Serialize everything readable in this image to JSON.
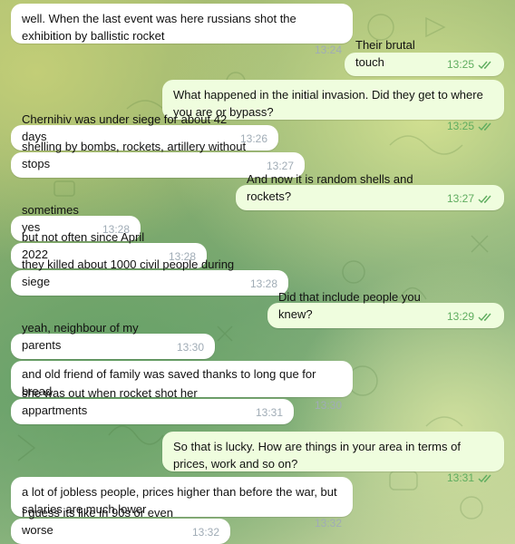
{
  "colors": {
    "incoming_bubble": "#ffffff",
    "outgoing_bubble": "#effdde",
    "time_incoming": "#a0acb6",
    "time_outgoing": "#5fad5f"
  },
  "messages": [
    {
      "direction": "in",
      "text": "well. When the last event was here russians shot the exhibition by ballistic rocket",
      "time": "13:24"
    },
    {
      "direction": "out",
      "text": "Their brutal touch",
      "time": "13:25",
      "read": true
    },
    {
      "direction": "out",
      "text": "What happened in the initial invasion. Did they get to where you are or bypass?",
      "time": "13:25",
      "read": true
    },
    {
      "direction": "in",
      "text": "Chernihiv was under siege for about 42 days",
      "time": "13:26"
    },
    {
      "direction": "in",
      "text": "shelling by bombs, rockets, artillery without stops",
      "time": "13:27"
    },
    {
      "direction": "out",
      "text": "And now it is random shells and rockets?",
      "time": "13:27",
      "read": true
    },
    {
      "direction": "in",
      "text": "sometimes yes",
      "time": "13:28"
    },
    {
      "direction": "in",
      "text": "but not often since April 2022",
      "time": "13:28"
    },
    {
      "direction": "in",
      "text": "they killed about 1000 civil people during siege",
      "time": "13:28"
    },
    {
      "direction": "out",
      "text": "Did that include people you knew?",
      "time": "13:29",
      "read": true
    },
    {
      "direction": "in",
      "text": "yeah, neighbour of my parents",
      "time": "13:30"
    },
    {
      "direction": "in",
      "text": "and old friend of family was saved thanks to long que for bread",
      "time": "13:30"
    },
    {
      "direction": "in",
      "text": "she was out when rocket shot her appartments",
      "time": "13:31"
    },
    {
      "direction": "out",
      "text": "So that is lucky. How are things in your area in terms of prices, work and so on?",
      "time": "13:31",
      "read": true
    },
    {
      "direction": "in",
      "text": "a lot of jobless people, prices higher than before the war, but salaries are much lower",
      "time": "13:32"
    },
    {
      "direction": "in",
      "text": "I guess its like in 90s or even worse",
      "time": "13:32"
    }
  ]
}
